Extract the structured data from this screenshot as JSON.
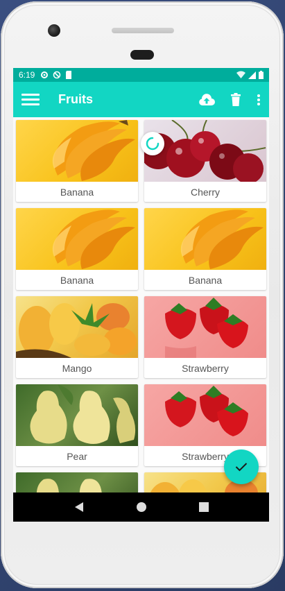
{
  "status_bar": {
    "time": "6:19",
    "left_icons": [
      "gear-icon",
      "block-icon",
      "sd-card-icon"
    ],
    "right_icons": [
      "wifi-icon",
      "signal-icon",
      "battery-icon"
    ]
  },
  "app_bar": {
    "title": "Fruits",
    "menu_icon": "hamburger-menu-icon",
    "actions": [
      "cloud-upload-icon",
      "delete-icon",
      "more-vert-icon"
    ]
  },
  "colors": {
    "accent": "#12d6c3",
    "status_bar": "#00ad9c",
    "label_text": "#555555"
  },
  "fruits": [
    {
      "label": "Banana",
      "image": "banana"
    },
    {
      "label": "Cherry",
      "image": "cherry"
    },
    {
      "label": "Banana",
      "image": "banana"
    },
    {
      "label": "Banana",
      "image": "banana"
    },
    {
      "label": "Mango",
      "image": "mango"
    },
    {
      "label": "Strawberry",
      "image": "strawberry"
    },
    {
      "label": "Pear",
      "image": "pear"
    },
    {
      "label": "Strawberry",
      "image": "strawberry"
    },
    {
      "label": "",
      "image": "pear"
    },
    {
      "label": "",
      "image": "mango"
    }
  ],
  "fab": {
    "icon": "check-icon"
  },
  "nav_bar": {
    "icons": [
      "back-icon",
      "home-icon",
      "recents-icon"
    ]
  }
}
